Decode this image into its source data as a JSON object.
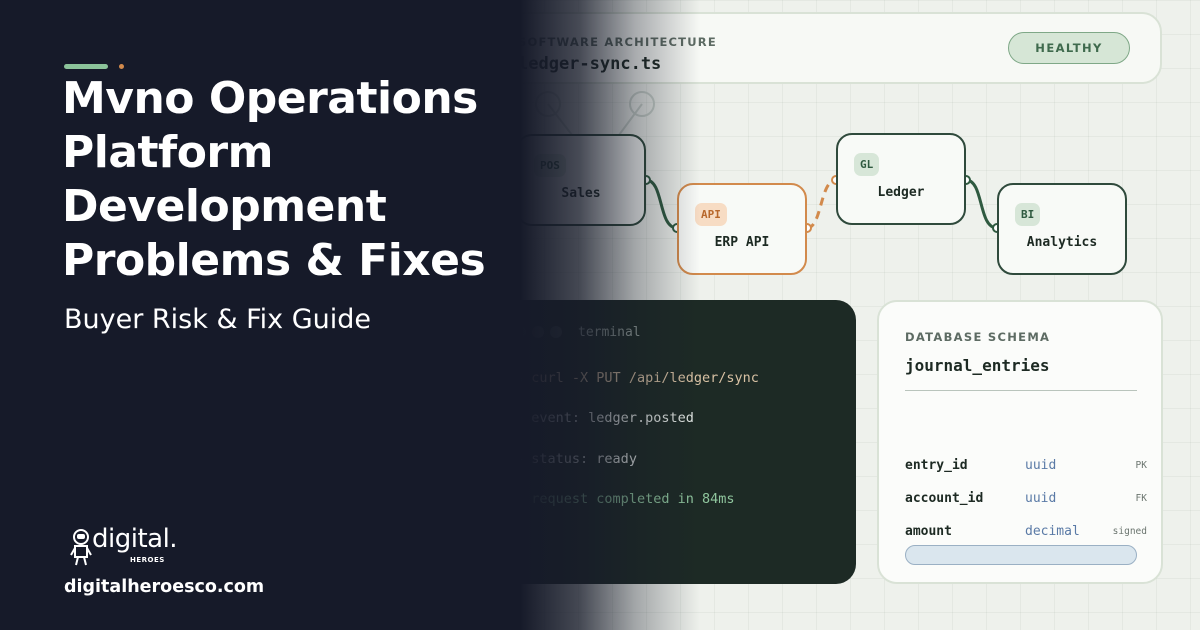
{
  "architecture": {
    "kicker": "SOFTWARE ARCHITECTURE",
    "file": "ledger-sync.ts",
    "status": "HEALTHY"
  },
  "diagram": {
    "nodes": [
      {
        "tag": "POS",
        "label": "Sales"
      },
      {
        "tag": "API",
        "label": "ERP API"
      },
      {
        "tag": "GL",
        "label": "Ledger"
      },
      {
        "tag": "BI",
        "label": "Analytics"
      }
    ]
  },
  "terminal": {
    "title": "terminal",
    "lines": [
      {
        "prefix": "$",
        "text": "curl -X PUT /api/ledger/sync"
      },
      {
        "prefix": "→",
        "text": "event: ledger.posted"
      },
      {
        "prefix": "→",
        "text": "status: ready"
      },
      {
        "prefix": "✓",
        "text": "request completed in 84ms"
      }
    ]
  },
  "schema": {
    "kicker": "DATABASE SCHEMA",
    "table": "journal_entries",
    "rows": [
      {
        "name": "entry_id",
        "type": "uuid",
        "key": "PK"
      },
      {
        "name": "account_id",
        "type": "uuid",
        "key": "FK"
      },
      {
        "name": "amount",
        "type": "decimal",
        "key": "signed"
      }
    ]
  },
  "hero": {
    "title_lines": [
      "Mvno Operations",
      "Platform",
      "Development",
      "Problems & Fixes"
    ],
    "subtitle": "Buyer Risk & Fix Guide"
  },
  "brand": {
    "logo_word": "digital.",
    "logo_sub": "HEROES",
    "url": "digitalheroesco.com",
    "accent_green": "#8bc39a",
    "accent_orange": "#d28a4c",
    "dark_bg": "#161a29"
  }
}
